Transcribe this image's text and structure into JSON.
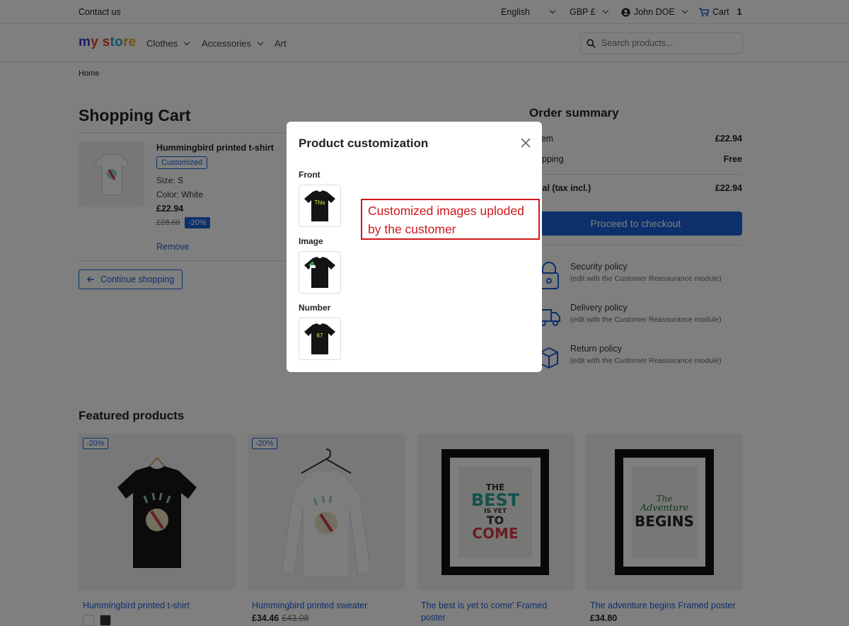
{
  "topbar": {
    "contact": "Contact us",
    "language": "English",
    "currency": "GBP £",
    "user": "John DOE",
    "cart_label": "Cart",
    "cart_count": "1"
  },
  "header": {
    "logo_parts": [
      "m",
      "y s",
      "to",
      "re"
    ],
    "nav": [
      "Clothes",
      "Accessories",
      "Art"
    ],
    "search_placeholder": "Search products..."
  },
  "breadcrumb": "Home",
  "cart": {
    "title": "Shopping Cart",
    "item": {
      "name": "Hummingbird printed t-shirt",
      "badge": "Customized",
      "size": "Size: S",
      "color": "Color: White",
      "price": "£22.94",
      "old_price": "£28.68",
      "discount": "-20%",
      "remove": "Remove"
    },
    "continue": "Continue shopping"
  },
  "summary": {
    "title": "Order summary",
    "rows": [
      {
        "label": "1 item",
        "value": "£22.94"
      },
      {
        "label": "Shipping",
        "value": "Free"
      },
      {
        "label": "Total (tax incl.)",
        "value": "£22.94"
      }
    ],
    "checkout": "Proceed to checkout",
    "reassurance": [
      {
        "title": "Security policy",
        "sub": "(edit with the Customer Reassurance module)"
      },
      {
        "title": "Delivery policy",
        "sub": "(edit with the Customer Reassurance module)"
      },
      {
        "title": "Return policy",
        "sub": "(edit with the Customer Reassurance module)"
      }
    ]
  },
  "featured": {
    "title": "Featured products",
    "products": [
      {
        "name": "Hummingbird printed t-shirt",
        "price": "",
        "old_price": "",
        "badge": "-20%"
      },
      {
        "name": "Hummingbird printed sweater",
        "price": "£34.46",
        "old_price": "£43.08",
        "badge": "-20%"
      },
      {
        "name": "The best is yet to come' Framed poster",
        "price": "",
        "old_price": "",
        "badge": ""
      },
      {
        "name": "The adventure begins Framed poster",
        "price": "£34.80",
        "old_price": "",
        "badge": ""
      }
    ]
  },
  "poster_texts": {
    "best": [
      "THE",
      "BEST",
      "IS YET",
      "TO",
      "COME"
    ],
    "adventure": [
      "The",
      "Adventure",
      "BEGINS"
    ]
  },
  "modal": {
    "title": "Product customization",
    "fields": [
      {
        "label": "Front",
        "image_text": "This"
      },
      {
        "label": "Image",
        "image_text": ""
      },
      {
        "label": "Number",
        "image_text": "67"
      }
    ]
  },
  "annotation": {
    "line1": "Customized images uploded",
    "line2": "by the customer"
  },
  "colors": {
    "accent": "#1a5fd8",
    "annotation": "#d0171b"
  }
}
